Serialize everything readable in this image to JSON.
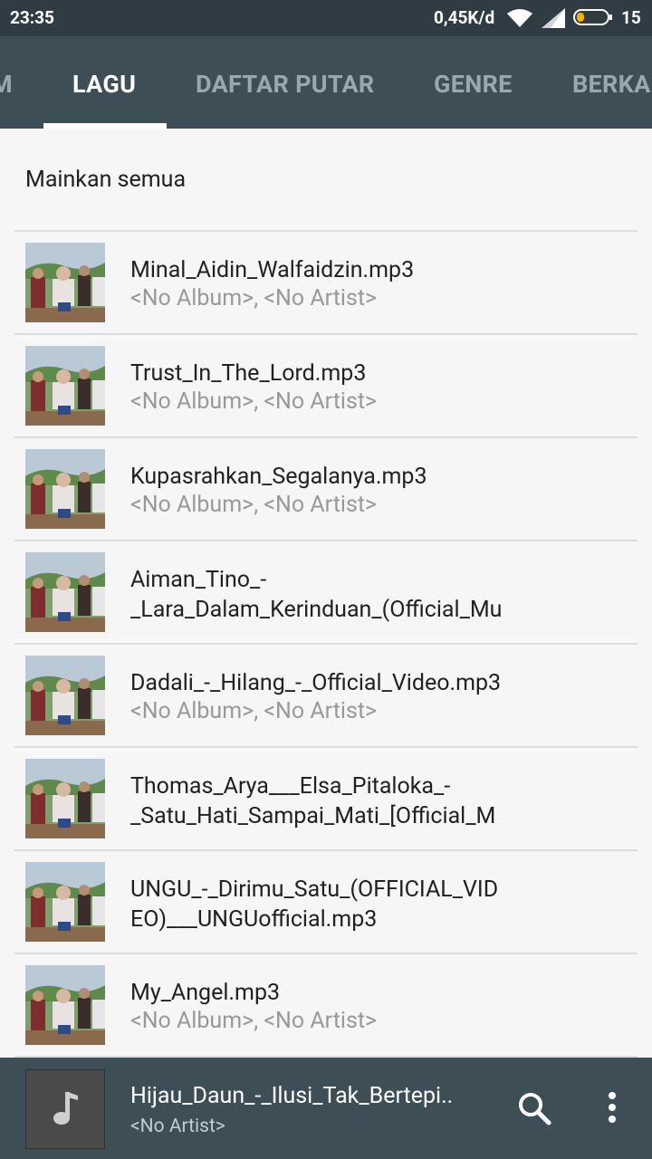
{
  "status_bar": {
    "time": "23:35",
    "network_speed": "0,45K/d",
    "battery_level": "15"
  },
  "tabs": [
    {
      "label": "M",
      "active": false
    },
    {
      "label": "LAGU",
      "active": true
    },
    {
      "label": "DAFTAR PUTAR",
      "active": false
    },
    {
      "label": "GENRE",
      "active": false
    },
    {
      "label": "BERKA",
      "active": false
    }
  ],
  "play_all_label": "Mainkan semua",
  "songs": [
    {
      "title": "Minal_Aidin_Walfaidzin.mp3",
      "subtitle": "<No Album>, <No Artist>"
    },
    {
      "title": "Trust_In_The_Lord.mp3",
      "subtitle": "<No Album>, <No Artist>"
    },
    {
      "title": "Kupasrahkan_Segalanya.mp3",
      "subtitle": "<No Album>, <No Artist>"
    },
    {
      "title": "Aiman_Tino_-\n_Lara_Dalam_Kerinduan_(Official_Mu",
      "subtitle": ""
    },
    {
      "title": "Dadali_-_Hilang_-_Official_Video.mp3",
      "subtitle": "<No Album>, <No Artist>"
    },
    {
      "title": "Thomas_Arya___Elsa_Pitaloka_-\n_Satu_Hati_Sampai_Mati_[Official_M",
      "subtitle": ""
    },
    {
      "title": "UNGU_-_Dirimu_Satu_(OFFICIAL_VID\nEO)___UNGUofficial.mp3",
      "subtitle": ""
    },
    {
      "title": "My_Angel.mp3",
      "subtitle": "<No Album>, <No Artist>"
    }
  ],
  "now_playing": {
    "title": "Hijau_Daun_-_Ilusi_Tak_Bertepi..",
    "artist": "<No Artist>"
  },
  "colors": {
    "status_bar": "#2f3c44",
    "tab_bar": "#3e4e57",
    "background": "#f6f6f6"
  }
}
